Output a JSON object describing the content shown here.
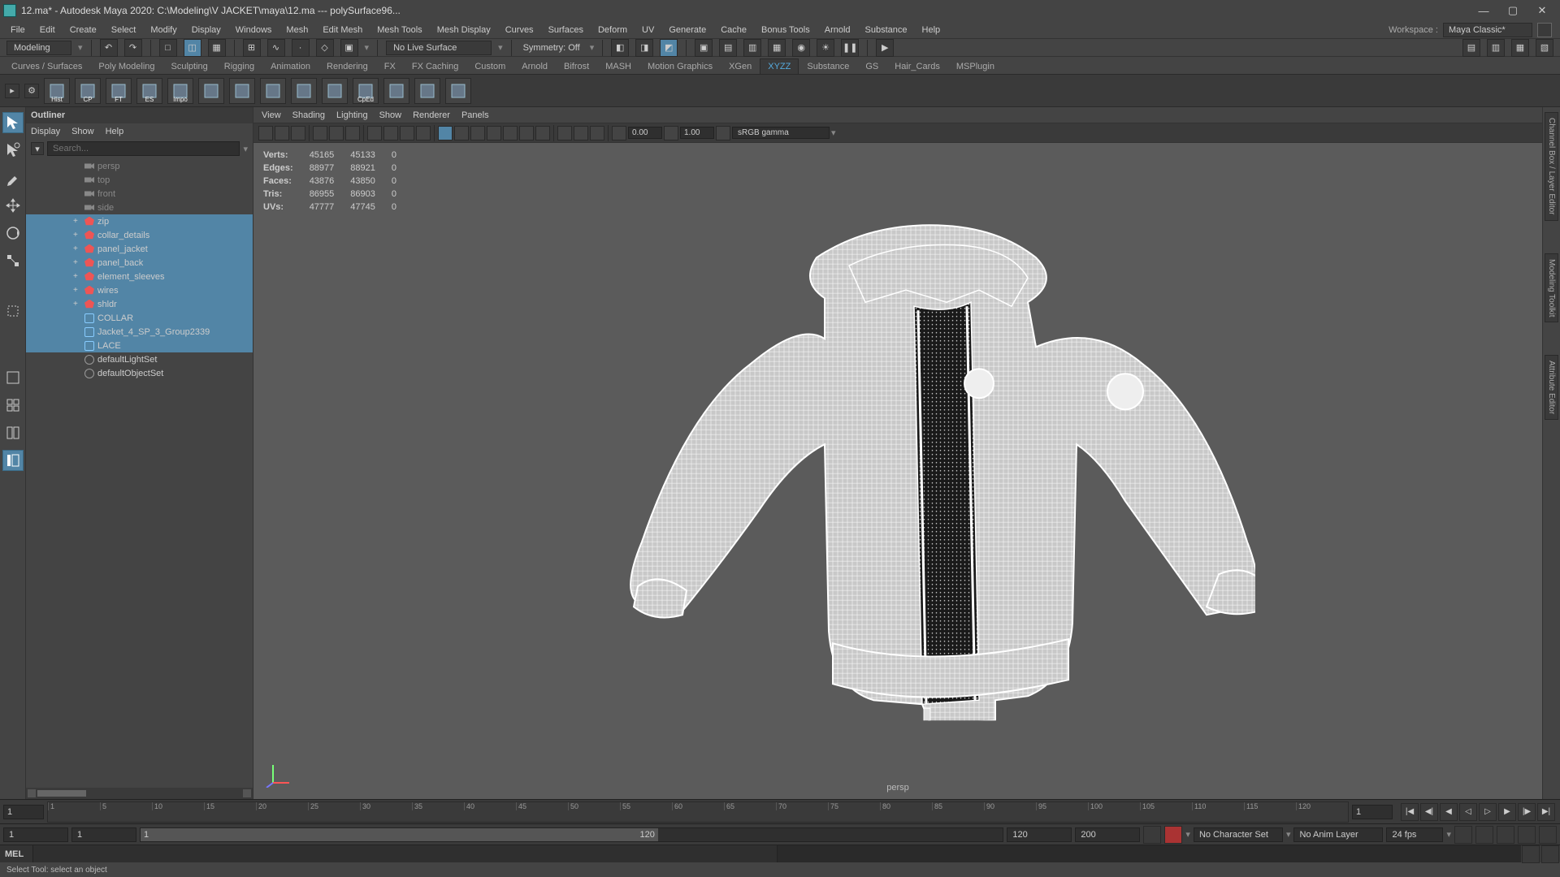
{
  "title": "12.ma* - Autodesk Maya 2020: C:\\Modeling\\V JACKET\\maya\\12.ma  ---  polySurface96...",
  "menubar": [
    "File",
    "Edit",
    "Create",
    "Select",
    "Modify",
    "Display",
    "Windows",
    "Mesh",
    "Edit Mesh",
    "Mesh Tools",
    "Mesh Display",
    "Curves",
    "Surfaces",
    "Deform",
    "UV",
    "Generate",
    "Cache",
    "Bonus Tools",
    "Arnold",
    "Substance",
    "Help"
  ],
  "workspace": {
    "label": "Workspace :",
    "value": "Maya Classic*"
  },
  "modemenu": "Modeling",
  "livesurface": "No Live Surface",
  "symmetry": "Symmetry: Off",
  "shelftabs": [
    "Curves / Surfaces",
    "Poly Modeling",
    "Sculpting",
    "Rigging",
    "Animation",
    "Rendering",
    "FX",
    "FX Caching",
    "Custom",
    "Arnold",
    "Bifrost",
    "MASH",
    "Motion Graphics",
    "XGen",
    "XYZZ",
    "Substance",
    "GS",
    "Hair_Cards",
    "MSPlugin"
  ],
  "shelf_active": "XYZZ",
  "shelf_icons": [
    {
      "lbl": "Hist",
      "name": "shelf-hist"
    },
    {
      "lbl": "CP",
      "name": "shelf-cp"
    },
    {
      "lbl": "FT",
      "name": "shelf-ft"
    },
    {
      "lbl": "ES",
      "name": "shelf-es"
    },
    {
      "lbl": "Impo",
      "name": "shelf-impo"
    },
    {
      "lbl": "",
      "name": "shelf-6"
    },
    {
      "lbl": "",
      "name": "shelf-7"
    },
    {
      "lbl": "",
      "name": "shelf-8"
    },
    {
      "lbl": "",
      "name": "shelf-9"
    },
    {
      "lbl": "",
      "name": "shelf-10"
    },
    {
      "lbl": "CpEd",
      "name": "shelf-cped"
    },
    {
      "lbl": "",
      "name": "shelf-12"
    },
    {
      "lbl": "",
      "name": "shelf-13"
    },
    {
      "lbl": "",
      "name": "shelf-14"
    }
  ],
  "outliner": {
    "title": "Outliner",
    "menus": [
      "Display",
      "Show",
      "Help"
    ],
    "search_ph": "Search...",
    "cameras": [
      "persp",
      "top",
      "front",
      "side"
    ],
    "nodes": [
      {
        "name": "zip",
        "sel": true,
        "exp": "+",
        "ico": "mesh"
      },
      {
        "name": "collar_details",
        "sel": true,
        "exp": "+",
        "ico": "mesh"
      },
      {
        "name": "panel_jacket",
        "sel": true,
        "exp": "+",
        "ico": "mesh"
      },
      {
        "name": "panel_back",
        "sel": true,
        "exp": "+",
        "ico": "mesh"
      },
      {
        "name": "element_sleeves",
        "sel": true,
        "exp": "+",
        "ico": "mesh"
      },
      {
        "name": "wires",
        "sel": true,
        "exp": "+",
        "ico": "mesh"
      },
      {
        "name": "shldr",
        "sel": true,
        "exp": "+",
        "ico": "mesh"
      },
      {
        "name": "COLLAR",
        "sel": true,
        "exp": "",
        "ico": "nurbs"
      },
      {
        "name": "Jacket_4_SP_3_Group2339",
        "sel": true,
        "exp": "",
        "ico": "nurbs"
      },
      {
        "name": "LACE",
        "sel": true,
        "exp": "",
        "ico": "nurbs"
      },
      {
        "name": "defaultLightSet",
        "sel": false,
        "exp": "",
        "ico": "set"
      },
      {
        "name": "defaultObjectSet",
        "sel": false,
        "exp": "",
        "ico": "set"
      }
    ]
  },
  "panelmenus": [
    "View",
    "Shading",
    "Lighting",
    "Show",
    "Renderer",
    "Panels"
  ],
  "exposure": "0.00",
  "gamma": "1.00",
  "colorspace": "sRGB gamma",
  "hud": {
    "rows": [
      {
        "k": "Verts:",
        "a": "45165",
        "b": "45133",
        "c": "0"
      },
      {
        "k": "Edges:",
        "a": "88977",
        "b": "88921",
        "c": "0"
      },
      {
        "k": "Faces:",
        "a": "43876",
        "b": "43850",
        "c": "0"
      },
      {
        "k": "Tris:",
        "a": "86955",
        "b": "86903",
        "c": "0"
      },
      {
        "k": "UVs:",
        "a": "47777",
        "b": "47745",
        "c": "0"
      }
    ]
  },
  "persp_label": "persp",
  "timeline": {
    "cur": "1",
    "ticks": [
      "1",
      "5",
      "10",
      "15",
      "20",
      "25",
      "30",
      "35",
      "40",
      "45",
      "50",
      "55",
      "60",
      "65",
      "70",
      "75",
      "80",
      "85",
      "90",
      "95",
      "100",
      "105",
      "110",
      "115",
      "120"
    ],
    "endcur": "1"
  },
  "range": {
    "start": "1",
    "instart": "1",
    "inend": "120",
    "end": "120",
    "total": "200",
    "charset": "No Character Set",
    "animlayer": "No Anim Layer",
    "fps": "24 fps"
  },
  "cmdlabel": "MEL",
  "helpline": "Select Tool: select an object",
  "rtabs": [
    "Channel Box / Layer Editor",
    "Modeling Toolkit",
    "Attribute Editor"
  ]
}
